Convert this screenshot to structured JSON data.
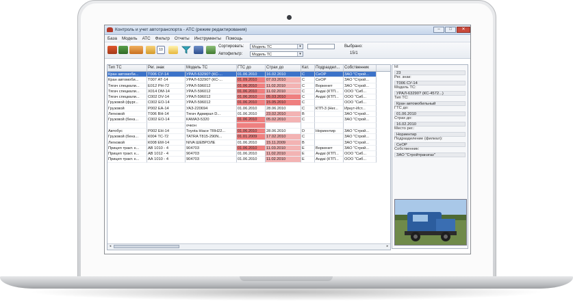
{
  "window": {
    "title": "Контроль и учет автотранспорта - АТС (режим редактирования)",
    "min_label": "–",
    "max_label": "□",
    "close_label": "✕"
  },
  "menu": [
    "База",
    "Модель",
    "АТС",
    "Фильтр",
    "Отчеты",
    "Инструменты",
    "Помощь"
  ],
  "toolbar": {
    "sort_label": "Сортировать:",
    "sort_value": "Модель ТС",
    "filter_label": "Автофильтр:",
    "filter_value": "Модель ТС",
    "shown_label": "Выбрано:",
    "shown_value": "15/1",
    "icon_badge": "10"
  },
  "grid": {
    "columns": [
      "Тип ТС",
      "Рег. знак",
      "Модель ТС",
      "ГТС до",
      "Страх до",
      "Кат.",
      "Подраздел...",
      "Собственник"
    ],
    "rows": [
      {
        "c": [
          "Кран автомоби...",
          "Т006 СУ-14",
          "УРАЛ-63290? (КС-...",
          "01.06.2010",
          "16.02.2010",
          "C",
          "СеОР",
          "ЗАО \"Строй..."
        ],
        "sel": true,
        "red": [],
        "pink": []
      },
      {
        "c": [
          "Кран автомоби...",
          "Т007 АТ-14",
          "УРАЛ-63290? (КС-...",
          "01.09.2010",
          "07.03.2010",
          "C",
          "СеОР",
          "ЗАО \"Строй..."
        ],
        "sel": false,
        "red": [
          3
        ],
        "pink": [
          4
        ]
      },
      {
        "c": [
          "Тягач специали...",
          "Е012 РН-72",
          "УРАЛ-596012",
          "01.06.2010",
          "11.02.2010",
          "C",
          "Воркенет",
          "ЗАО \"Строй..."
        ],
        "sel": false,
        "red": [
          3
        ],
        "pink": [
          4
        ]
      },
      {
        "c": [
          "Тягач специали...",
          "Х014 DM-14",
          "УРАЛ-596012",
          "01.06.2010",
          "11.02.2010",
          "C",
          "Андаі (КТП...",
          "ООО \"Сиб..."
        ],
        "sel": false,
        "red": [
          3
        ],
        "pink": [
          4
        ]
      },
      {
        "c": [
          "Тягач специали...",
          "С002 DV-14",
          "УРАЛ-596012",
          "01.06.2010",
          "05.03.2010",
          "C",
          "Андаі (КТП...",
          "ООО \"Сиб..."
        ],
        "sel": false,
        "red": [
          3,
          4
        ],
        "pink": []
      },
      {
        "c": [
          "Грузовой (фург...",
          "С002 ЕО-14",
          "УРАЛ-596012",
          "01.06.2010",
          "15.05.2010",
          "C",
          "",
          "ООО \"Сиб..."
        ],
        "sel": false,
        "red": [
          3,
          4
        ],
        "pink": []
      },
      {
        "c": [
          "Грузовой",
          "Р002 ЕА-14",
          "УАЗ-220694",
          "01.06.2010",
          "28.06.2010",
          "C",
          "КТП-3 (Нег...",
          "Иркут-Ист..."
        ],
        "sel": false,
        "red": [],
        "pink": []
      },
      {
        "c": [
          "Легковой",
          "Т006 ВН-14",
          "Тягач Адмирал D...",
          "01.06.2010",
          "23.02.2010",
          "B",
          "",
          "ЗАО \"Строй..."
        ],
        "sel": false,
        "red": [],
        "pink": [
          4
        ]
      },
      {
        "c": [
          "Грузовой (бенз...",
          "С002 ЕО-14",
          "КАМАЗ-5320",
          "01.06.2010",
          "05.02.2010",
          "C",
          "",
          "ЗАО \"Строй..."
        ],
        "sel": false,
        "red": [
          3
        ],
        "pink": [
          4
        ]
      },
      {
        "c": [
          "",
          "",
          "очкон",
          "",
          "",
          "",
          "",
          ""
        ],
        "sel": false,
        "red": [
          3
        ],
        "pink": []
      },
      {
        "c": [
          "Автобус",
          "Р002 ЕН-14",
          "Toyota Hiace TRH22...",
          "01.06.2010",
          "28.06.2010",
          "D",
          "Нориентир",
          "ЗАО \"Строй..."
        ],
        "sel": false,
        "red": [
          3
        ],
        "pink": []
      },
      {
        "c": [
          "Грузовой (бенз...",
          "К004 ТС-72",
          "TATRA T815-290N...",
          "01.01.2009",
          "17.02.2010",
          "C",
          "",
          "ЗАО \"Строй..."
        ],
        "sel": false,
        "red": [
          3
        ],
        "pink": [
          4
        ]
      },
      {
        "c": [
          "Легковой",
          "К008 ЕМ-14",
          "NIVA ШЕВРОЛЕ",
          "01.06.2010",
          "15.11.2009",
          "B",
          "",
          "ЗАО \"Строй..."
        ],
        "sel": false,
        "red": [],
        "pink": [
          4
        ]
      },
      {
        "c": [
          "Прицеп тракт. к...",
          "АВ 1010 - 4",
          "904703",
          "01.06.2010",
          "11.03.2010",
          "E",
          "Воркенет",
          "ЗАО \"Строй..."
        ],
        "sel": false,
        "red": [
          3
        ],
        "pink": [
          4
        ]
      },
      {
        "c": [
          "Прицеп тракт. к...",
          "АВ 1012 - 4",
          "904703",
          "01.06.2010",
          "11.02.2010",
          "E",
          "Андаі (КТП...",
          "ООО \"Сиб..."
        ],
        "sel": false,
        "red": [],
        "pink": [
          4
        ]
      },
      {
        "c": [
          "Прицеп тракт. к...",
          "АА 1010 - 4",
          "904703",
          "01.06.2010",
          "11.02.2010",
          "E",
          "Андаі (КТП...",
          "ООО \"Сиб..."
        ],
        "sel": false,
        "red": [],
        "pink": [
          4
        ]
      }
    ]
  },
  "details": [
    {
      "label": "Id:",
      "value": "23"
    },
    {
      "label": "Рег. знак:",
      "value": "Т006 СУ-14"
    },
    {
      "label": "Модель ТС:",
      "value": "УРАЛ-63290? (КС-4572...)"
    },
    {
      "label": "Тип ТС:",
      "value": "Кран автомобильный"
    },
    {
      "label": "ГТС до:",
      "value": "01.06.2010"
    },
    {
      "label": "Страх до:",
      "value": "16.02.2010"
    },
    {
      "label": "Место рег.:",
      "value": "Нориентир"
    },
    {
      "label": "Подразделение (филиал):",
      "value": "СеОР"
    },
    {
      "label": "Собственник:",
      "value": "ЗАО \"Стройтранзгаз\""
    }
  ],
  "colors": {
    "selected": "#3c73c9",
    "overdue": "#ef7f7f",
    "warning": "#f3b3b3"
  }
}
